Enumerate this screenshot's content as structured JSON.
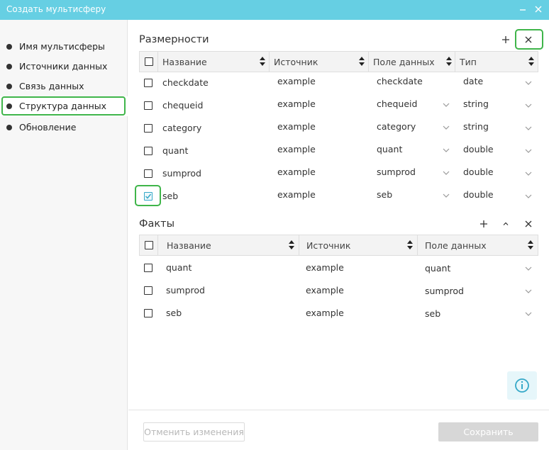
{
  "window": {
    "title": "Создать мультисферу"
  },
  "steps": [
    {
      "label": "Имя мультисферы"
    },
    {
      "label": "Источники данных"
    },
    {
      "label": "Связь данных"
    },
    {
      "label": "Структура данных"
    },
    {
      "label": "Обновление"
    }
  ],
  "active_step": "Структура данных",
  "dimensions": {
    "title": "Размерности",
    "add_icon": "+",
    "remove_icon": "×",
    "headers": [
      "Название",
      "Источник",
      "Поле данных",
      "Тип"
    ],
    "rows": [
      {
        "name": "checkdate",
        "source": "example",
        "field": "checkdate",
        "type": "date",
        "checked": false
      },
      {
        "name": "chequeid",
        "source": "example",
        "field": "chequeid",
        "type": "string",
        "checked": false
      },
      {
        "name": "category",
        "source": "example",
        "field": "category",
        "type": "string",
        "checked": false
      },
      {
        "name": "quant",
        "source": "example",
        "field": "quant",
        "type": "double",
        "checked": false
      },
      {
        "name": "sumprod",
        "source": "example",
        "field": "sumprod",
        "type": "double",
        "checked": false
      },
      {
        "name": "seb",
        "source": "example",
        "field": "seb",
        "type": "double",
        "checked": true
      }
    ]
  },
  "facts": {
    "title": "Факты",
    "add_icon": "+",
    "up_icon": "^",
    "remove_icon": "×",
    "headers": [
      "Название",
      "Источник",
      "Поле данных"
    ],
    "rows": [
      {
        "name": "quant",
        "source": "example",
        "field": "quant",
        "checked": false
      },
      {
        "name": "sumprod",
        "source": "example",
        "field": "sumprod",
        "checked": false
      },
      {
        "name": "seb",
        "source": "example",
        "field": "seb",
        "checked": false
      }
    ]
  },
  "buttons": {
    "revert": "Отменить изменения",
    "save": "Сохранить"
  },
  "colors": {
    "titlebar": "#66cfe3",
    "highlight": "#3fb54a",
    "checkbox_checked": "#35a8c8",
    "save_disabled": "#d7d7d7"
  }
}
